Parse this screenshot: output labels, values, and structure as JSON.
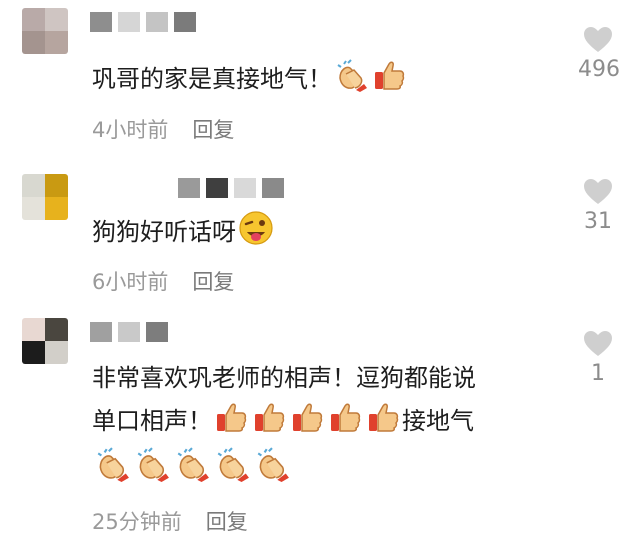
{
  "comments": [
    {
      "text": "巩哥的家是真接地气！",
      "emojis": [
        "clap-emoji",
        "thumbs-up-emoji"
      ],
      "time": "4小时前",
      "reply": "回复",
      "likes": "496",
      "avatar_colors": [
        "#b9aaa8",
        "#cfc5c2",
        "#a4948f",
        "#b6a59f"
      ],
      "name_colors": [
        "#8e8e8e",
        "#d6d6d6",
        "#c4c4c4",
        "#7b7b7b"
      ]
    },
    {
      "text": "狗狗好听话呀",
      "emojis": [
        "wink-tongue-emoji"
      ],
      "time": "6小时前",
      "reply": "回复",
      "likes": "31",
      "avatar_colors": [
        "#d8d8d0",
        "#c99a12",
        "#e4e2da",
        "#e7b21d"
      ],
      "name_colors": [
        "#9a9a9a",
        "#3f3f3f",
        "#d9d9d9",
        "#8a8a8a"
      ]
    },
    {
      "text_line1": "非常喜欢巩老师的相声！逗狗都能说",
      "text_line2": "单口相声！",
      "text_line2_tail": "接地气",
      "line2_emojis": [
        "thumbs-up-emoji",
        "thumbs-up-emoji",
        "thumbs-up-emoji",
        "thumbs-up-emoji",
        "thumbs-up-emoji"
      ],
      "line3_emojis": [
        "clap-emoji",
        "clap-emoji",
        "clap-emoji",
        "clap-emoji",
        "clap-emoji"
      ],
      "time": "25分钟前",
      "reply": "回复",
      "likes": "1",
      "avatar_colors": [
        "#e8d8d2",
        "#4a463f",
        "#1c1c1c",
        "#d2cfc9"
      ],
      "name_colors": [
        "#a0a0a0",
        "#c9c9c9",
        "#7d7d7d"
      ]
    }
  ],
  "colors": {
    "heart": "#cfcfcf",
    "time": "#9a9a9a",
    "count": "#8c8c8c"
  }
}
